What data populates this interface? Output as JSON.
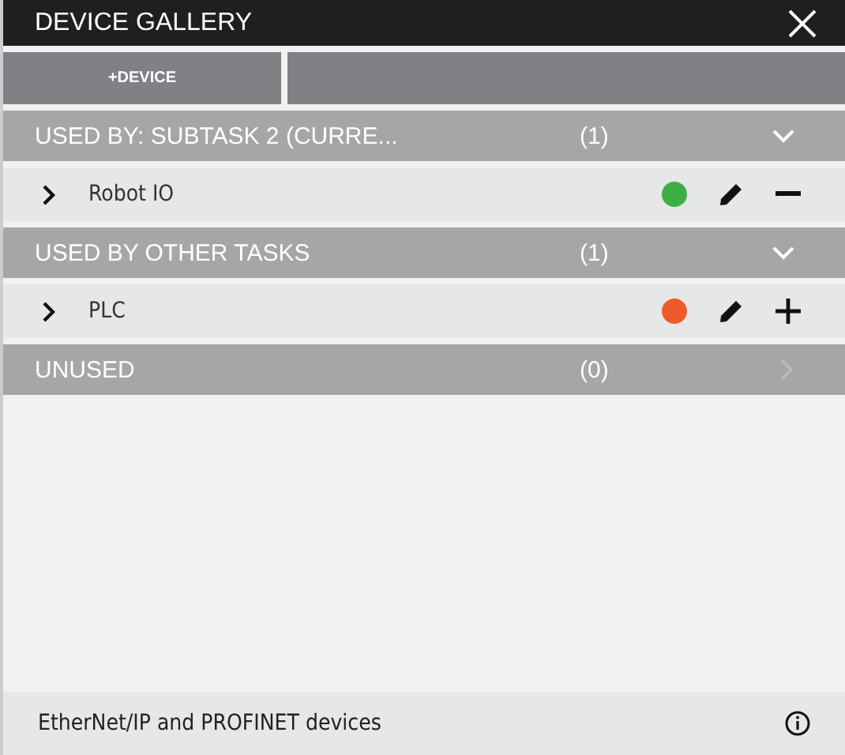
{
  "window": {
    "title": "DEVICE GALLERY"
  },
  "toolbar": {
    "buttons": [
      "+DEVICE"
    ]
  },
  "sections": [
    {
      "title": "USED BY: SUBTASK 2 (CURRE...",
      "count": "(1)",
      "expanded": true,
      "items": [
        {
          "name": "Robot IO",
          "color": "#3cb043",
          "kind": "remove"
        }
      ]
    },
    {
      "title": "USED BY OTHER TASKS",
      "count": "(1)",
      "expanded": true,
      "items": [
        {
          "name": "PLC",
          "color": "#f05a28",
          "kind": "add"
        }
      ]
    },
    {
      "title": "UNUSED",
      "count": "(0)",
      "expanded": false
    }
  ],
  "status_bar": {
    "text": "EtherNet/IP and PROFINET devices"
  }
}
